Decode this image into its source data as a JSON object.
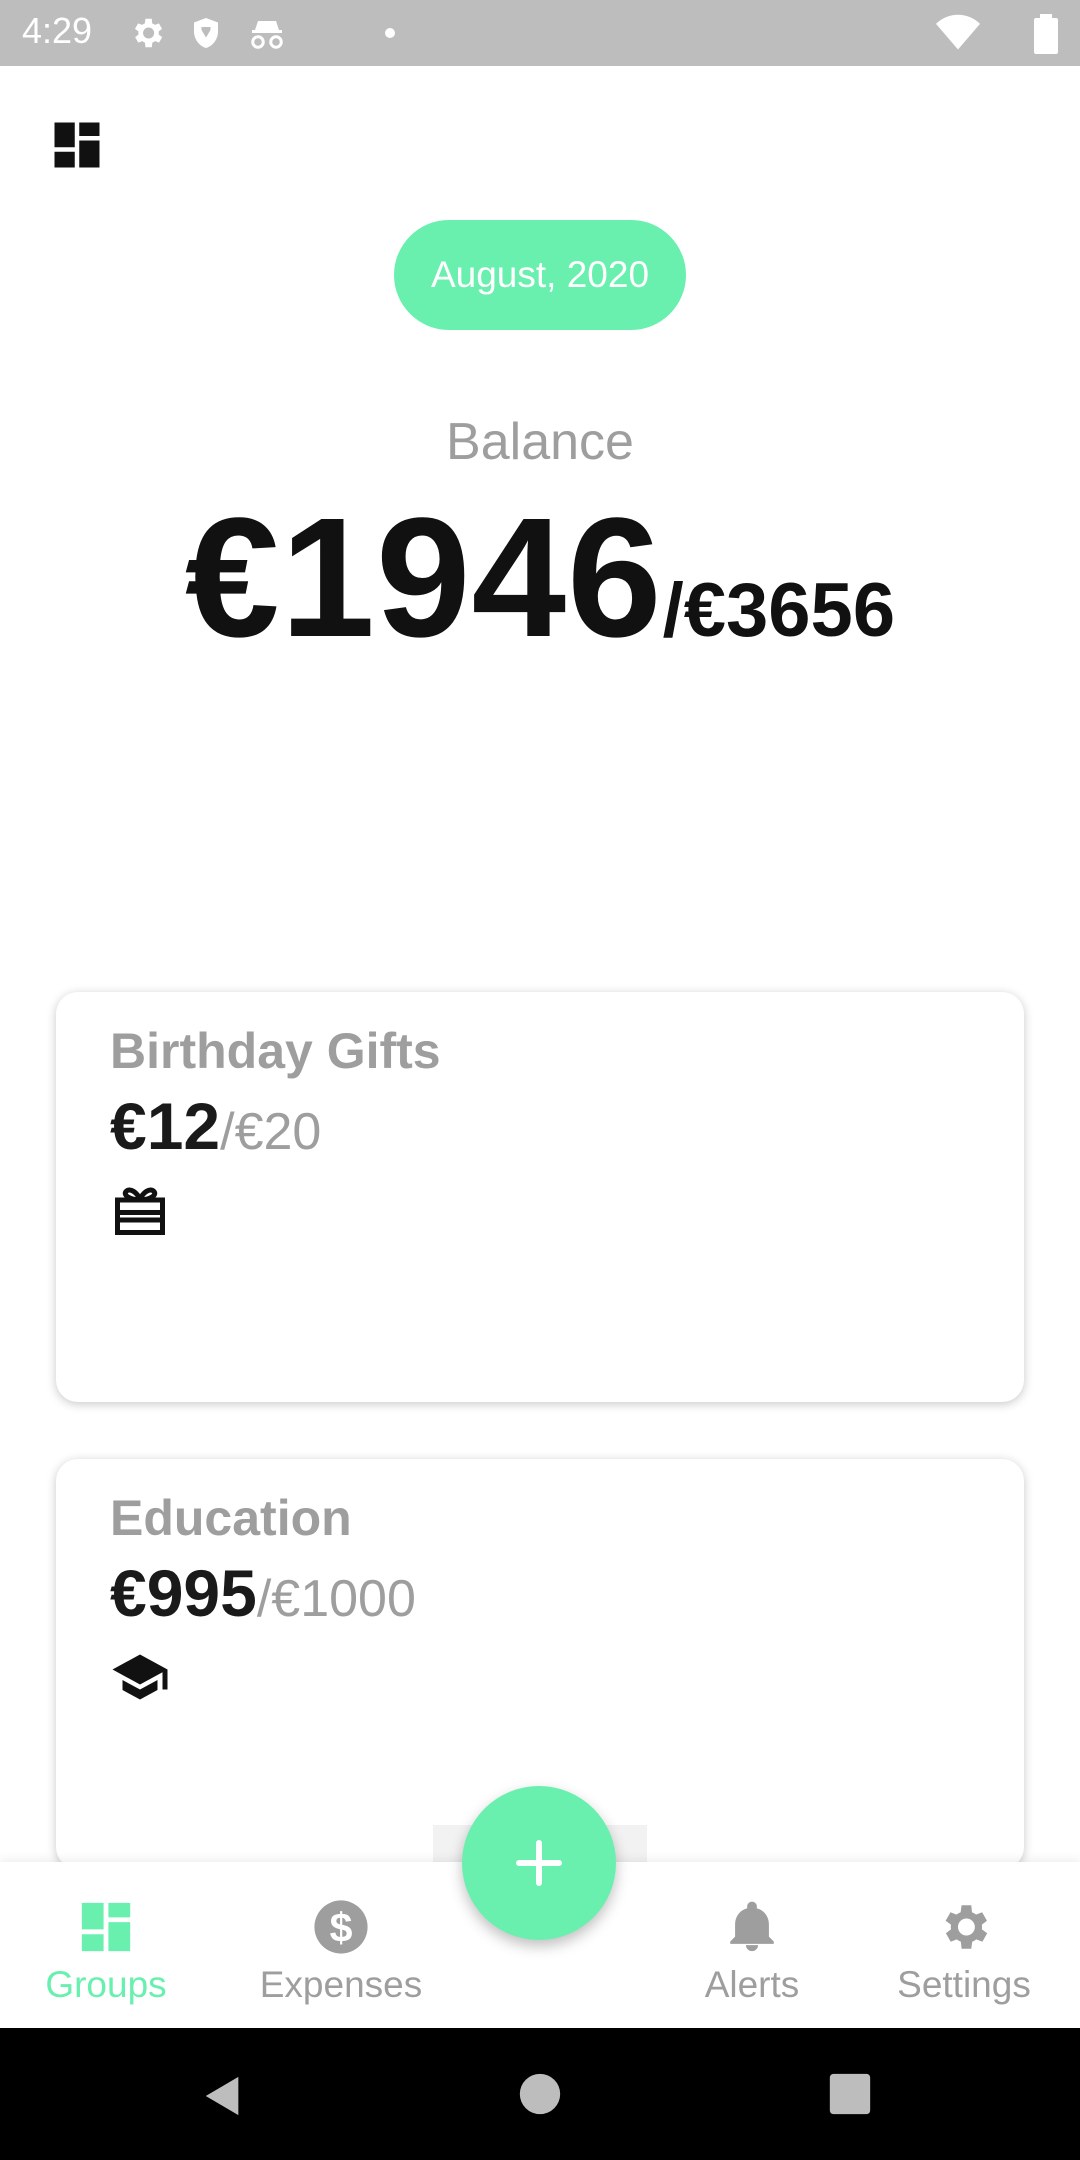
{
  "status_bar": {
    "time": "4:29"
  },
  "header": {
    "month": "August, 2020"
  },
  "balance": {
    "label": "Balance",
    "spent": "€1946",
    "total": "/€3656"
  },
  "groups": [
    {
      "title": "Birthday Gifts",
      "spent": "€12",
      "budget": "/€20",
      "icon": "gift-card-icon"
    },
    {
      "title": "Education",
      "spent": "€995",
      "budget": "/€1000",
      "icon": "graduation-cap-icon"
    }
  ],
  "bottom_nav": {
    "items": [
      {
        "label": "Groups",
        "icon": "dashboard-icon",
        "active": true
      },
      {
        "label": "Expenses",
        "icon": "dollar-circle-icon",
        "active": false
      },
      {
        "label": "Alerts",
        "icon": "bell-icon",
        "active": false
      },
      {
        "label": "Settings",
        "icon": "gear-icon",
        "active": false
      }
    ],
    "fab_icon": "plus-icon"
  },
  "colors": {
    "accent": "#69f0ae",
    "muted": "#9e9e9e",
    "text": "#111111"
  }
}
